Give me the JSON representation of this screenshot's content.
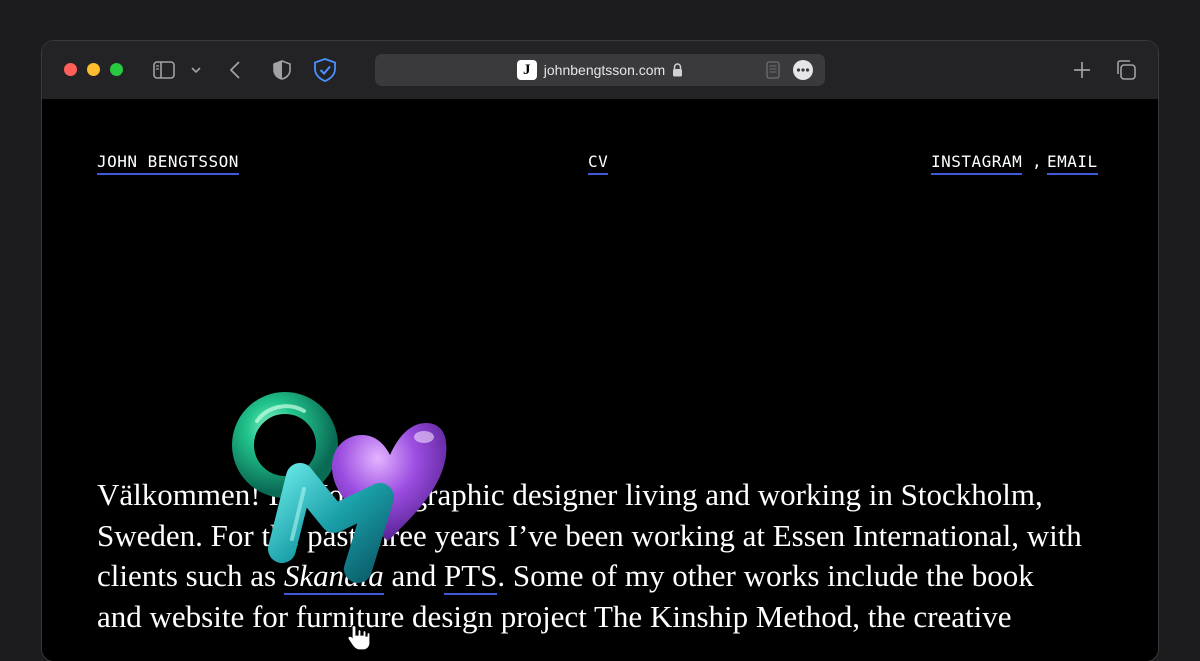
{
  "browser": {
    "url": "johnbengtsson.com",
    "favicon_letter": "J",
    "icons": [
      "sidebar-icon",
      "chevron-down-icon",
      "back-icon",
      "shield-icon",
      "privacy-shield-icon",
      "lock-icon",
      "reader-icon",
      "more-icon",
      "new-tab-icon",
      "tabs-overview-icon"
    ]
  },
  "nav": {
    "name": "JOHN BENGTSSON",
    "cv": "CV",
    "instagram": "INSTAGRAM",
    "separator": ",",
    "email": "EMAIL"
  },
  "intro": {
    "line1": "Välkommen! I'm John, a graphic designer living and working in Stockholm,",
    "line2_a": "Sweden. For the past three years I’ve been working at Essen International, with",
    "line3_a": "clients such as ",
    "client1": "Skandia",
    "line3_b": " and ",
    "client2": "PTS",
    "line3_c": ". Some of my other works include the book",
    "line4": "and website for furniture design project The Kinship Method, the creative"
  },
  "colors": {
    "link_underline": "#3d5bd9",
    "background": "#000000",
    "toolbar": "#232325"
  }
}
